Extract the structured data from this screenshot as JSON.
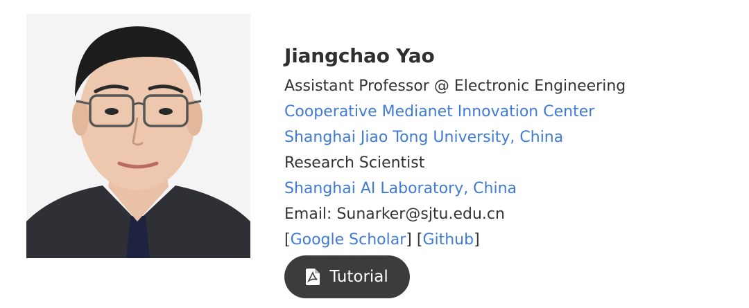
{
  "profile": {
    "photo_icon": "profile-photo",
    "name": "Jiangchao Yao",
    "title": "Assistant Professor @ Electronic Engineering",
    "affiliation_1": "Cooperative Medianet Innovation Center",
    "affiliation_2": "Shanghai Jiao Tong University, China",
    "role_2": "Research Scientist",
    "affiliation_3": "Shanghai AI Laboratory, China",
    "email_line": "Email: Sunarker@sjtu.edu.cn",
    "links": {
      "bracket_open": "[",
      "google_scholar": "Google Scholar",
      "bracket_close_open": "] [",
      "github": "Github",
      "bracket_close": "]"
    }
  },
  "actions": {
    "tutorial_label": "Tutorial",
    "tutorial_icon": "pdf-file-icon"
  },
  "colors": {
    "link": "#3f7ad6",
    "text": "#333333",
    "button_bg": "#3c3c3c"
  }
}
